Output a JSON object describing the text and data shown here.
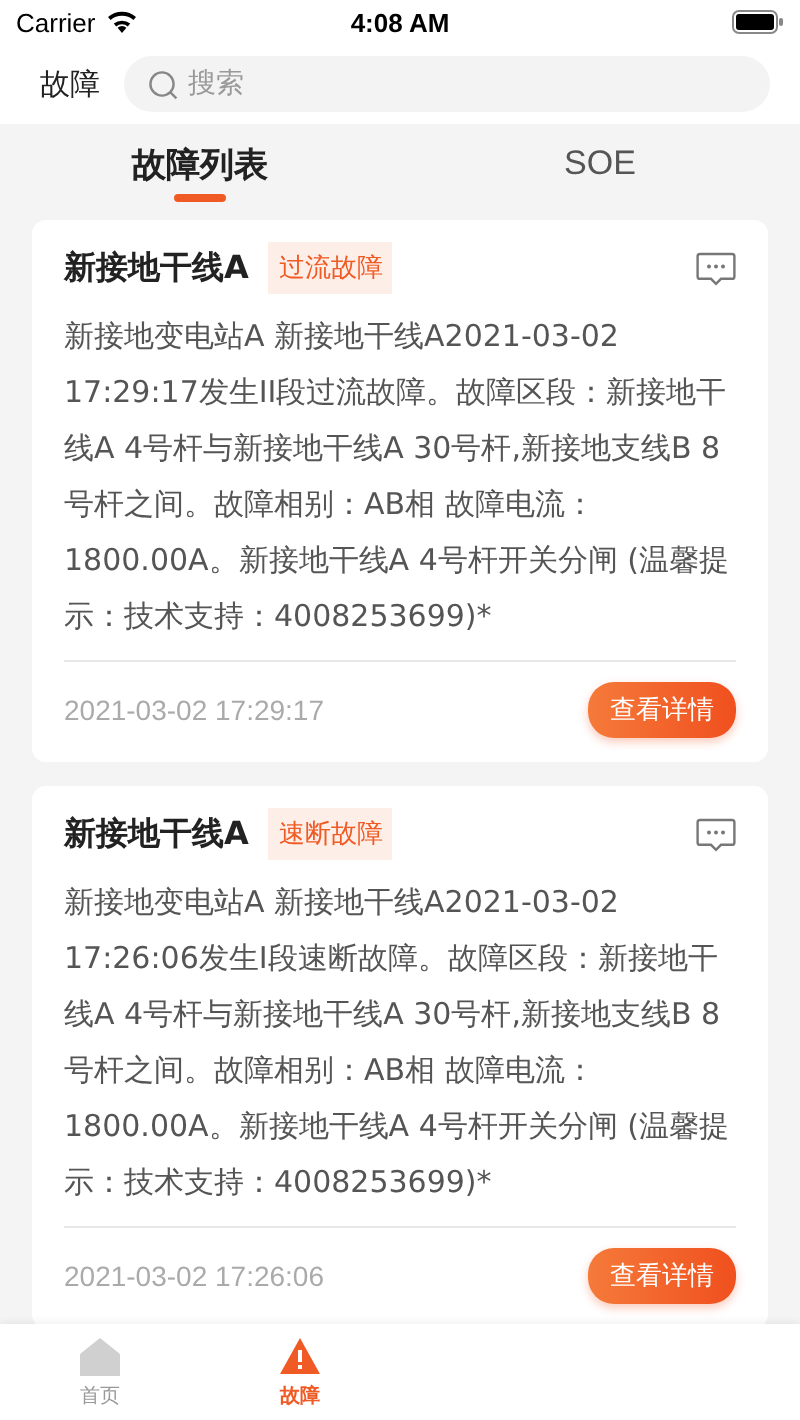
{
  "status_bar": {
    "carrier": "Carrier",
    "time": "4:08 AM"
  },
  "header": {
    "title": "故障",
    "search": {
      "placeholder": "搜索"
    }
  },
  "tabs": [
    {
      "label": "故障列表",
      "selected": true
    },
    {
      "label": "SOE",
      "selected": false
    }
  ],
  "faults": [
    {
      "line": "新接地干线A",
      "tag": "过流故障",
      "description": "新接地变电站A 新接地干线A2021-03-02 17:29:17发生II段过流故障。故障区段：新接地干线A 4号杆与新接地干线A 30号杆,新接地支线B 8号杆之间。故障相别：AB相 故障电流：1800.00A。新接地干线A 4号杆开关分闸 (温馨提示：技术支持：4008253699)*",
      "time": "2021-03-02 17:29:17",
      "button": "查看详情"
    },
    {
      "line": "新接地干线A",
      "tag": "速断故障",
      "description": "新接地变电站A 新接地干线A2021-03-02 17:26:06发生I段速断故障。故障区段：新接地干线A 4号杆与新接地干线A 30号杆,新接地支线B 8号杆之间。故障相别：AB相 故障电流：1800.00A。新接地干线A 4号杆开关分闸 (温馨提示：技术支持：4008253699)*",
      "time": "2021-03-02 17:26:06",
      "button": "查看详情"
    }
  ],
  "tab_bar": [
    {
      "label": "首页",
      "kind": "home",
      "selected": false
    },
    {
      "label": "故障",
      "kind": "alert",
      "selected": true
    }
  ]
}
